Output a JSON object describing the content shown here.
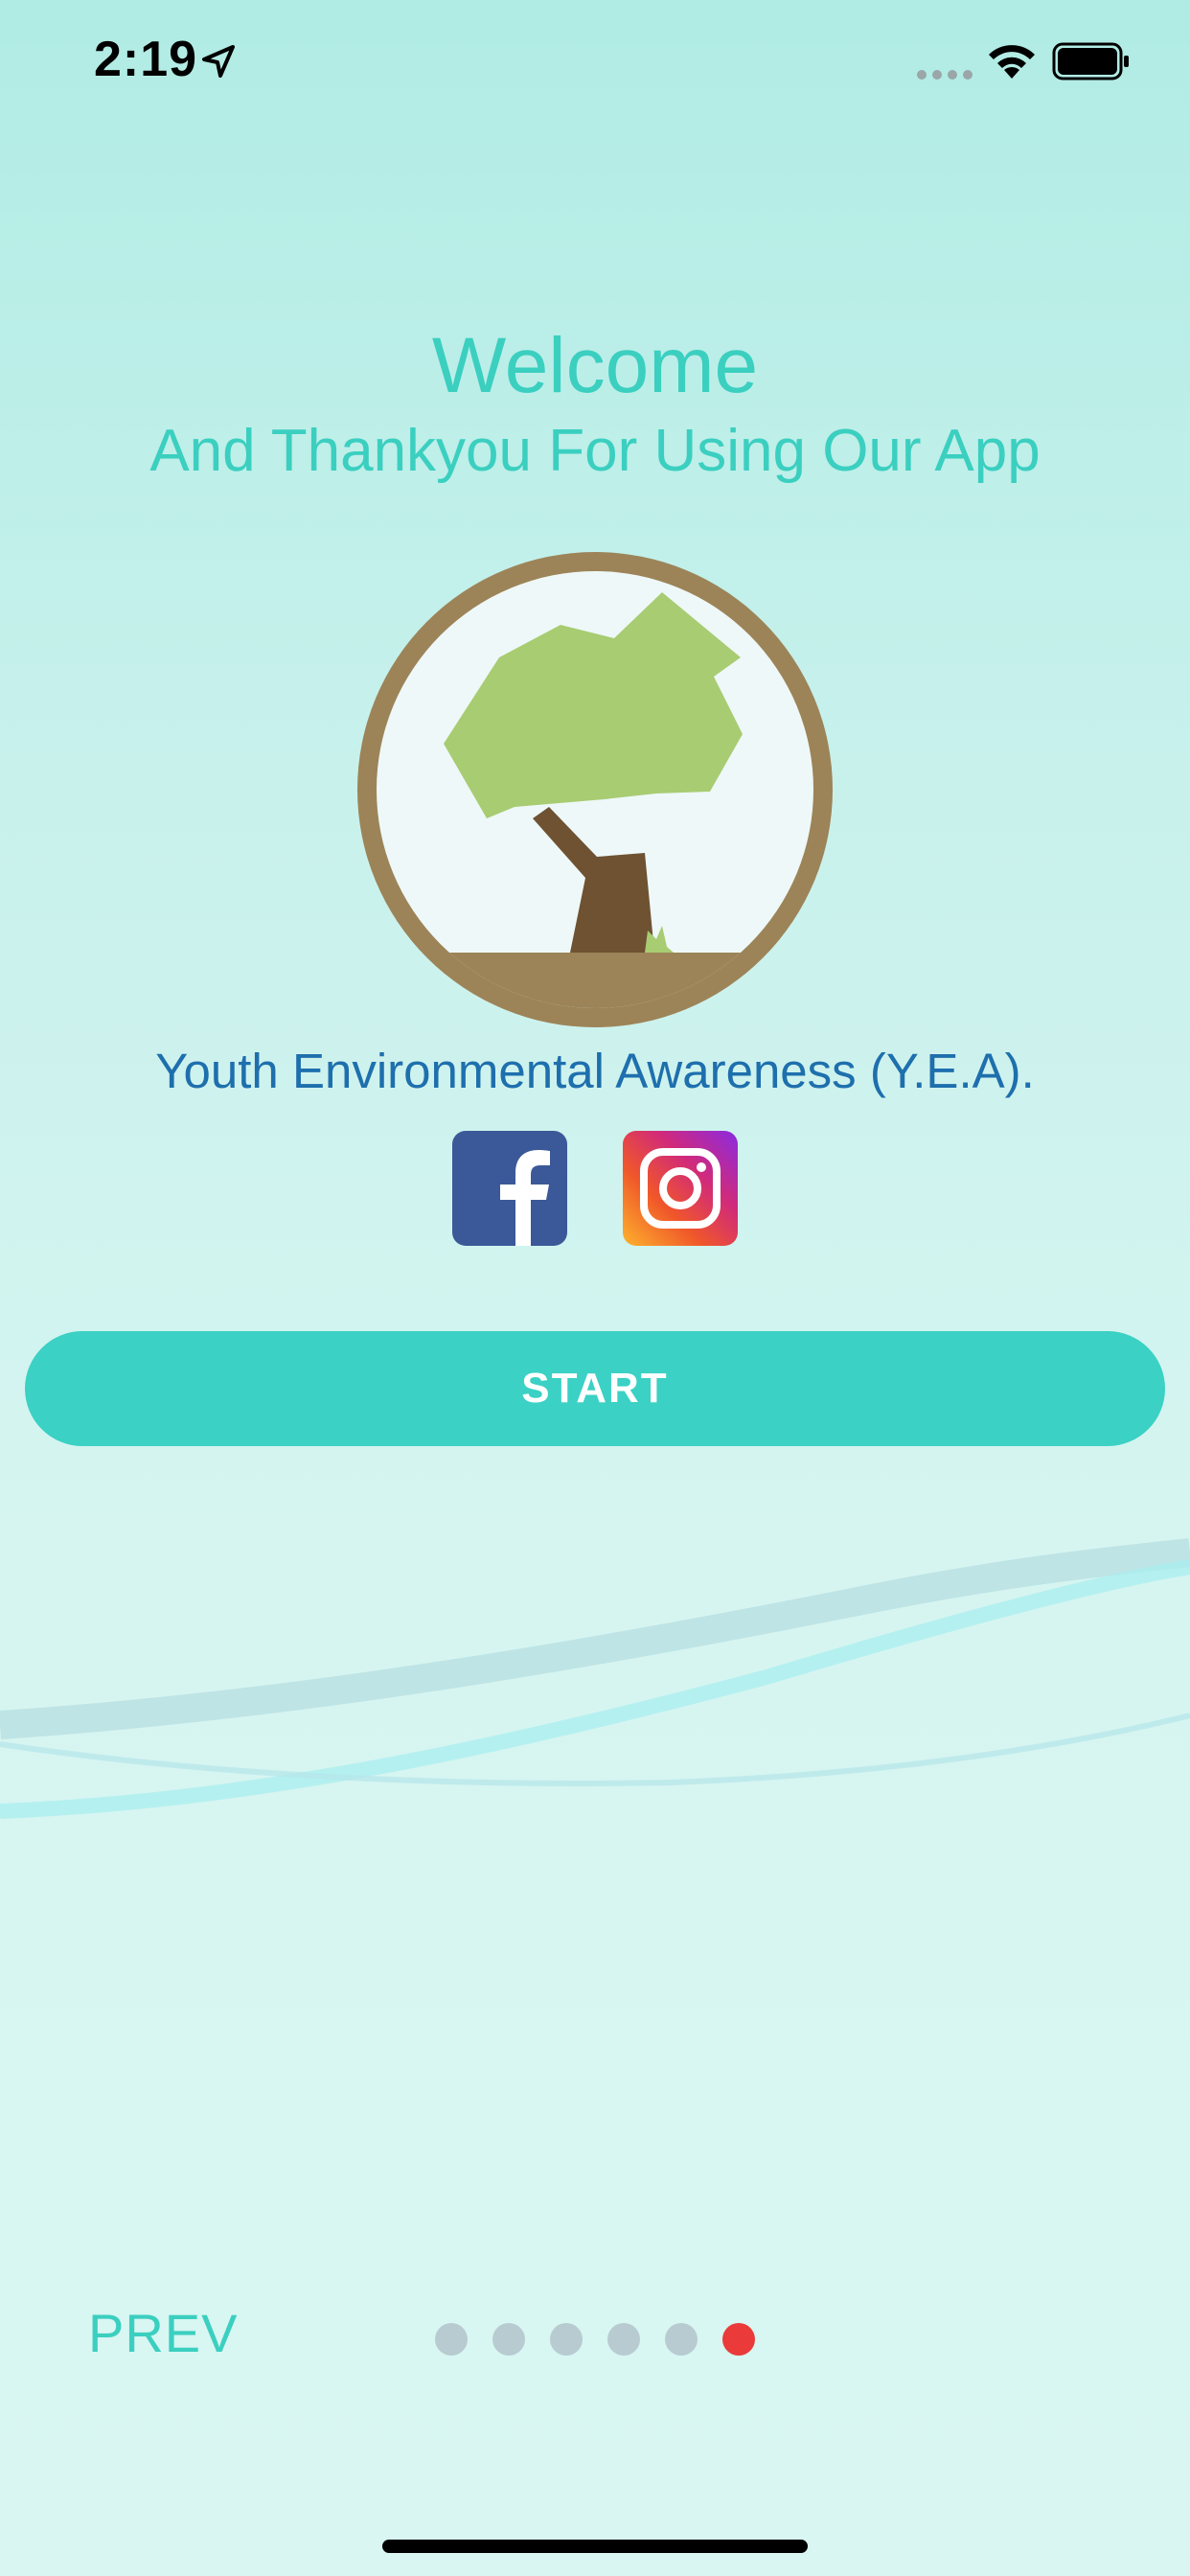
{
  "status_bar": {
    "time": "2:19",
    "icons": [
      "location-arrow-icon",
      "cellular-signal-icon",
      "wifi-icon",
      "battery-icon"
    ]
  },
  "welcome": {
    "title": "Welcome",
    "subtitle": "And Thankyou For Using Our App"
  },
  "logo": {
    "icon": "tree-logo-icon"
  },
  "organization": {
    "name": "Youth Environmental Awareness (Y.E.A)."
  },
  "social": {
    "items": [
      {
        "name": "facebook",
        "icon": "facebook-icon",
        "color": "#3b5998"
      },
      {
        "name": "instagram",
        "icon": "instagram-icon"
      }
    ]
  },
  "actions": {
    "start_label": "START"
  },
  "pager": {
    "prev_label": "PREV",
    "total_pages": 6,
    "current_page": 6,
    "active_color": "#ea3a3a",
    "inactive_color": "#b8cbd1"
  },
  "colors": {
    "accent": "#3bd1c4",
    "title_text": "#3bcfc0",
    "org_text": "#1e6fad"
  }
}
